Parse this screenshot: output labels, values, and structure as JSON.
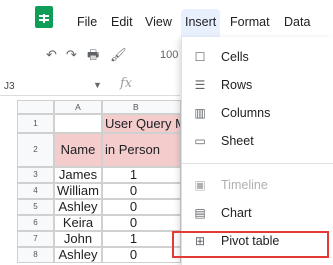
{
  "menubar": {
    "items": [
      "File",
      "Edit",
      "View",
      "Insert",
      "Format",
      "Data"
    ],
    "active": "Insert"
  },
  "toolbar": {
    "zoom_partial": "100"
  },
  "formula_bar": {
    "cell_ref": "J3",
    "fx": "fx"
  },
  "grid": {
    "columns": [
      "A",
      "B"
    ],
    "rows": [
      "1",
      "2",
      "3",
      "4",
      "5",
      "6",
      "7",
      "8"
    ],
    "header_row1_b": "User Query M",
    "header_row2_a": "Name",
    "header_row2_b": "in Person",
    "data": [
      {
        "name": "James",
        "value": "1"
      },
      {
        "name": "William",
        "value": "0"
      },
      {
        "name": "Ashley",
        "value": "0"
      },
      {
        "name": "Keira",
        "value": "0"
      },
      {
        "name": "John",
        "value": "1"
      },
      {
        "name": "Ashley",
        "value": "0"
      }
    ],
    "colors": {
      "header_fill": "#f4cccc"
    }
  },
  "insert_menu": {
    "items": [
      {
        "label": "Cells",
        "icon": "square-icon"
      },
      {
        "label": "Rows",
        "icon": "rows-icon"
      },
      {
        "label": "Columns",
        "icon": "columns-icon"
      },
      {
        "label": "Sheet",
        "icon": "sheet-icon"
      },
      {
        "label": "Timeline",
        "icon": "timeline-icon",
        "disabled": true
      },
      {
        "label": "Chart",
        "icon": "chart-icon"
      },
      {
        "label": "Pivot table",
        "icon": "pivot-table-icon",
        "highlighted": true
      }
    ],
    "highlight_color": "#e53935"
  }
}
